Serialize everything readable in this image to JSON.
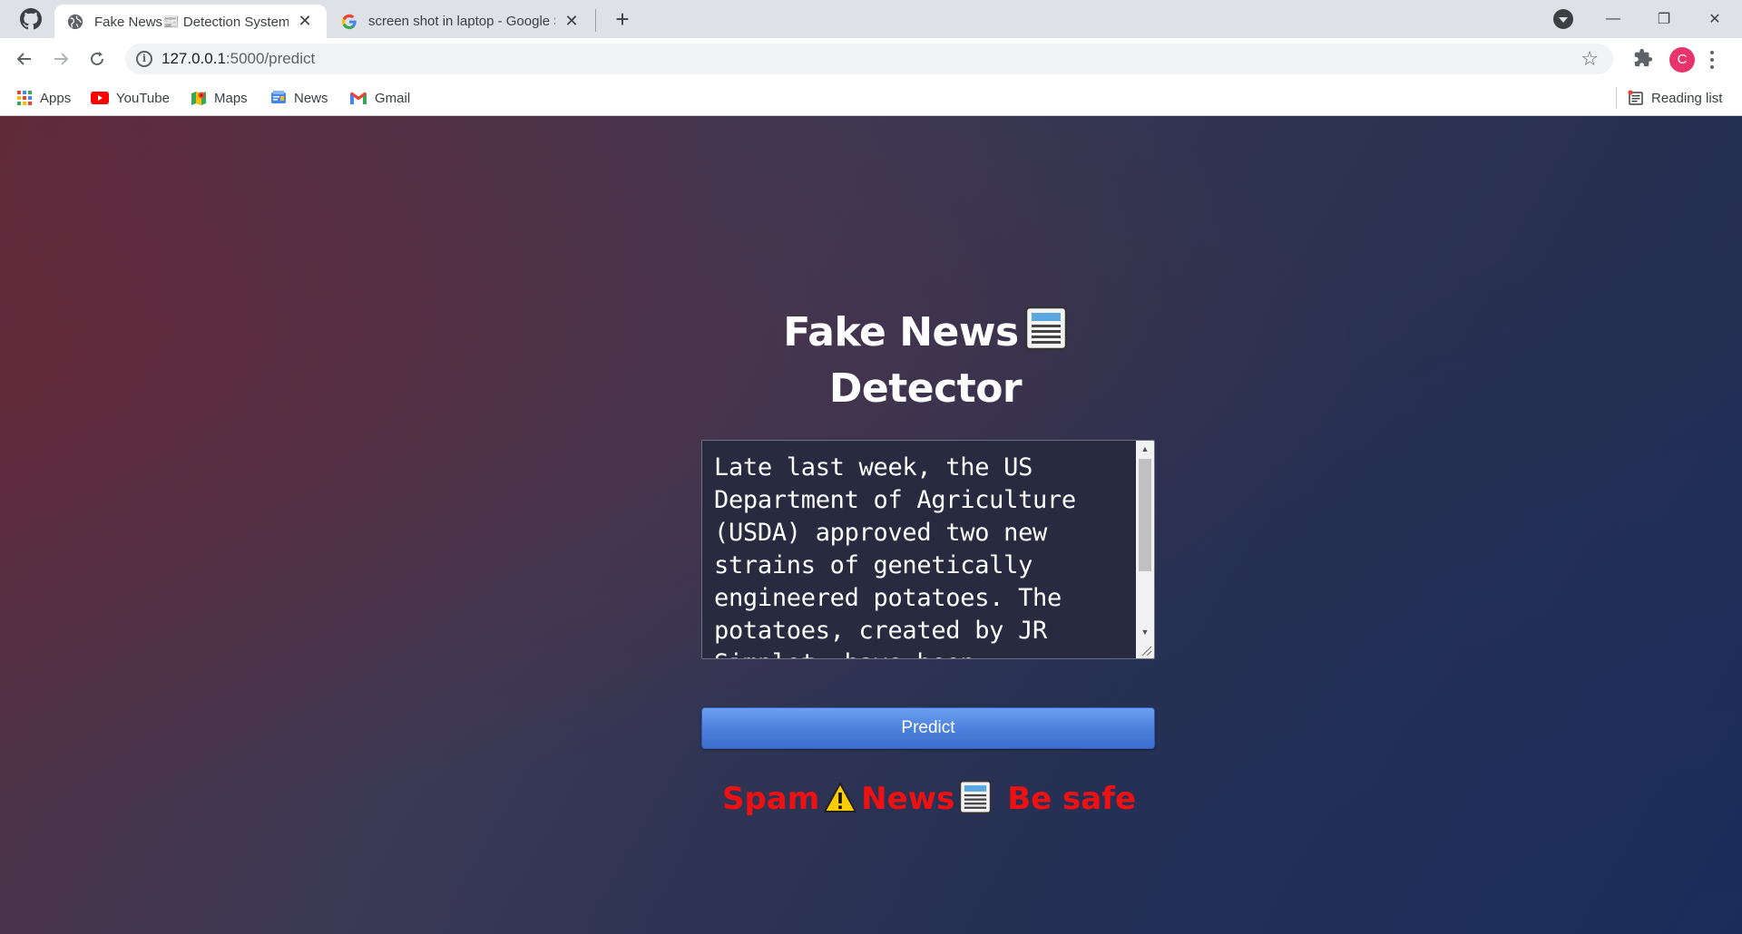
{
  "browser": {
    "tabs": [
      {
        "title": "Fake News📰 Detection System",
        "close": "✕",
        "active": true
      },
      {
        "title": "screen shot in laptop - Google Se",
        "close": "✕",
        "active": false
      }
    ],
    "new_tab": "+",
    "window_controls": {
      "minimize": "—",
      "restore": "❐",
      "close": "✕"
    },
    "address": {
      "host": "127.0.0.1",
      "path": ":5000/predict"
    },
    "bookmarks": [
      {
        "label": "Apps",
        "icon": "apps-grid-icon"
      },
      {
        "label": "YouTube",
        "icon": "youtube-icon"
      },
      {
        "label": "Maps",
        "icon": "maps-icon"
      },
      {
        "label": "News",
        "icon": "news-icon"
      },
      {
        "label": "Gmail",
        "icon": "gmail-icon"
      }
    ],
    "reading_list": "Reading list",
    "profile_initial": "C"
  },
  "page": {
    "heading_line1": "Fake News",
    "heading_line2": "Detector",
    "input_text": "Late last week, the US Department of Agriculture (USDA) approved two new strains of genetically engineered potatoes. The potatoes, created by JR Simplot, have been",
    "predict_label": "Predict",
    "result": {
      "part1": "Spam",
      "part2": "News",
      "part3": "Be safe"
    }
  },
  "colors": {
    "result_red": "#ee1111",
    "button_blue": "#4a80dc",
    "profile_pink": "#e8336d"
  }
}
